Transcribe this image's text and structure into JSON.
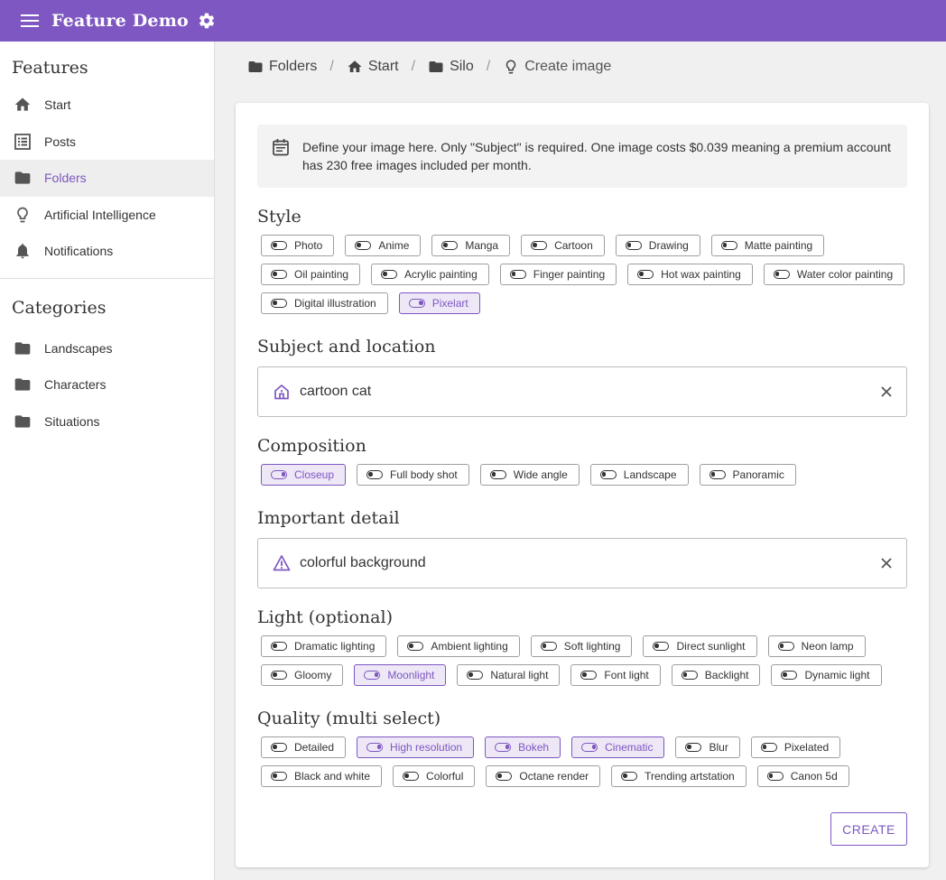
{
  "app": {
    "title": "Feature Demo"
  },
  "sidebar": {
    "features_heading": "Features",
    "features": [
      {
        "label": "Start",
        "icon": "home-icon"
      },
      {
        "label": "Posts",
        "icon": "list-icon"
      },
      {
        "label": "Folders",
        "icon": "folder-icon",
        "active": true
      },
      {
        "label": "Artificial Intelligence",
        "icon": "lightbulb-icon"
      },
      {
        "label": "Notifications",
        "icon": "bell-icon"
      }
    ],
    "categories_heading": "Categories",
    "categories": [
      {
        "label": "Landscapes",
        "icon": "folder-icon"
      },
      {
        "label": "Characters",
        "icon": "folder-icon"
      },
      {
        "label": "Situations",
        "icon": "folder-icon"
      }
    ]
  },
  "breadcrumb": [
    {
      "label": "Folders",
      "icon": "folder-icon"
    },
    {
      "label": "Start",
      "icon": "home-icon"
    },
    {
      "label": "Silo",
      "icon": "folder-icon"
    },
    {
      "label": "Create image",
      "icon": "lightbulb-icon"
    }
  ],
  "info": {
    "text": "Define your image here. Only \"Subject\" is required. One image costs $0.039 meaning a premium account has 230 free images included per month."
  },
  "style": {
    "title": "Style",
    "options": [
      {
        "label": "Photo",
        "selected": false
      },
      {
        "label": "Anime",
        "selected": false
      },
      {
        "label": "Manga",
        "selected": false
      },
      {
        "label": "Cartoon",
        "selected": false
      },
      {
        "label": "Drawing",
        "selected": false
      },
      {
        "label": "Matte painting",
        "selected": false
      },
      {
        "label": "Oil painting",
        "selected": false
      },
      {
        "label": "Acrylic painting",
        "selected": false
      },
      {
        "label": "Finger painting",
        "selected": false
      },
      {
        "label": "Hot wax painting",
        "selected": false
      },
      {
        "label": "Water color painting",
        "selected": false
      },
      {
        "label": "Digital illustration",
        "selected": false
      },
      {
        "label": "Pixelart",
        "selected": true
      }
    ]
  },
  "subject": {
    "title": "Subject and location",
    "value": "cartoon cat"
  },
  "composition": {
    "title": "Composition",
    "options": [
      {
        "label": "Closeup",
        "selected": true
      },
      {
        "label": "Full body shot",
        "selected": false
      },
      {
        "label": "Wide angle",
        "selected": false
      },
      {
        "label": "Landscape",
        "selected": false
      },
      {
        "label": "Panoramic",
        "selected": false
      }
    ]
  },
  "detail": {
    "title": "Important detail",
    "value": "colorful background"
  },
  "light": {
    "title": "Light (optional)",
    "options": [
      {
        "label": "Dramatic lighting",
        "selected": false
      },
      {
        "label": "Ambient lighting",
        "selected": false
      },
      {
        "label": "Soft lighting",
        "selected": false
      },
      {
        "label": "Direct sunlight",
        "selected": false
      },
      {
        "label": "Neon lamp",
        "selected": false
      },
      {
        "label": "Gloomy",
        "selected": false
      },
      {
        "label": "Moonlight",
        "selected": true
      },
      {
        "label": "Natural light",
        "selected": false
      },
      {
        "label": "Font light",
        "selected": false
      },
      {
        "label": "Backlight",
        "selected": false
      },
      {
        "label": "Dynamic light",
        "selected": false
      }
    ]
  },
  "quality": {
    "title": "Quality (multi select)",
    "options": [
      {
        "label": "Detailed",
        "selected": false
      },
      {
        "label": "High resolution",
        "selected": true
      },
      {
        "label": "Bokeh",
        "selected": true
      },
      {
        "label": "Cinematic",
        "selected": true
      },
      {
        "label": "Blur",
        "selected": false
      },
      {
        "label": "Pixelated",
        "selected": false
      },
      {
        "label": "Black and white",
        "selected": false
      },
      {
        "label": "Colorful",
        "selected": false
      },
      {
        "label": "Octane render",
        "selected": false
      },
      {
        "label": "Trending artstation",
        "selected": false
      },
      {
        "label": "Canon 5d",
        "selected": false
      }
    ]
  },
  "actions": {
    "create": "CREATE"
  },
  "colors": {
    "accent": "#7e57c2",
    "accent_light": "#ede7f6",
    "icon": "#555555"
  }
}
